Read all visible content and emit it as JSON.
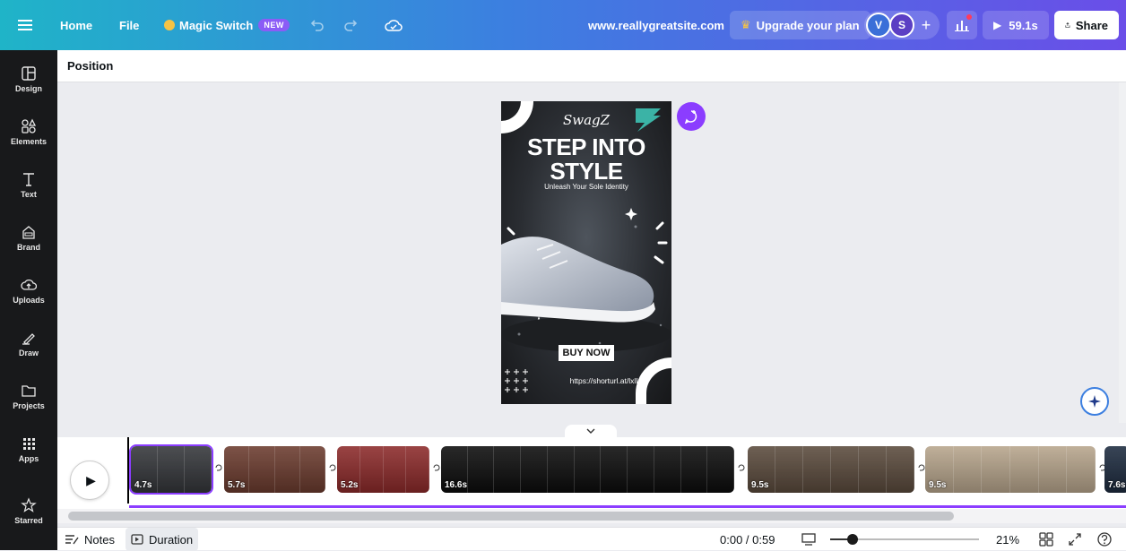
{
  "topbar": {
    "menu_icon": "hamburger-icon",
    "home": "Home",
    "file": "File",
    "magic_switch": "Magic Switch",
    "new_badge": "NEW",
    "site": "www.reallygreatsite.com",
    "upgrade": "Upgrade your plan",
    "avatars": [
      "V",
      "S"
    ],
    "play_time": "59.1s",
    "share": "Share"
  },
  "sidebar": {
    "items": [
      {
        "label": "Design",
        "icon": "layout-icon"
      },
      {
        "label": "Elements",
        "icon": "shapes-icon"
      },
      {
        "label": "Text",
        "icon": "text-icon"
      },
      {
        "label": "Brand",
        "icon": "brand-icon"
      },
      {
        "label": "Uploads",
        "icon": "cloud-upload-icon"
      },
      {
        "label": "Draw",
        "icon": "pen-icon"
      },
      {
        "label": "Projects",
        "icon": "folder-icon"
      },
      {
        "label": "Apps",
        "icon": "grid-icon"
      },
      {
        "label": "Starred",
        "icon": "star-icon"
      }
    ]
  },
  "context": {
    "position": "Position"
  },
  "poster": {
    "brand": "SwagZ",
    "headline_1": "STEP INTO",
    "headline_2": "STYLE",
    "tagline": "Unleash Your Sole Identity",
    "cta": "BUY NOW",
    "url": "https://shorturl.at/lxlI4"
  },
  "timeline": {
    "clips": [
      {
        "duration": "4.7s",
        "color": "#34363a",
        "frames": 3
      },
      {
        "duration": "5.7s",
        "color": "#6b3b2e",
        "frames": 4
      },
      {
        "duration": "5.2s",
        "color": "#8c2a2a",
        "frames": 4
      },
      {
        "duration": "16.6s",
        "color": "#0c0c0c",
        "frames": 11
      },
      {
        "duration": "9.5s",
        "color": "#5a4a3c",
        "frames": 6
      },
      {
        "duration": "9.5s",
        "color": "#b7a58c",
        "frames": 6
      },
      {
        "duration": "7.6s",
        "color": "#1d2b3f",
        "frames": 1
      }
    ]
  },
  "bottom": {
    "notes": "Notes",
    "duration": "Duration",
    "timecode": "0:00 / 0:59",
    "zoom": "21%",
    "zoom_level": 0.15
  },
  "colors": {
    "accent": "#8b3dff",
    "dark": "#18191b"
  }
}
